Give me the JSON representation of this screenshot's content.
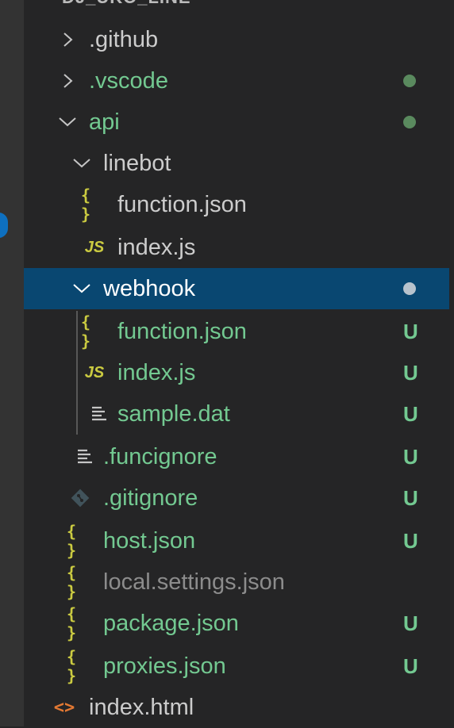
{
  "explorer": {
    "root_label": "DJ_UKO_LINE",
    "colors": {
      "untracked": "#73c991",
      "plain": "#cccccc",
      "ignored": "#8c8c8c",
      "selected_bg": "#094771",
      "json_icon": "#cbcb41",
      "js_icon": "#cbcb41",
      "html_icon": "#e37933"
    },
    "items": [
      {
        "label": ".github",
        "icon": "chevron-right-icon",
        "status": ""
      },
      {
        "label": ".vscode",
        "icon": "chevron-right-icon",
        "status": "dot"
      },
      {
        "label": "api",
        "icon": "chevron-down-icon",
        "status": "dot"
      },
      {
        "label": "linebot",
        "icon": "chevron-down-icon",
        "status": ""
      },
      {
        "label": "function.json",
        "icon": "json-file-icon",
        "icon_text": "{ }",
        "status": ""
      },
      {
        "label": "index.js",
        "icon": "js-file-icon",
        "icon_text": "JS",
        "status": ""
      },
      {
        "label": "webhook",
        "icon": "chevron-down-icon",
        "status": "dot",
        "selected": true
      },
      {
        "label": "function.json",
        "icon": "json-file-icon",
        "icon_text": "{ }",
        "status": "U"
      },
      {
        "label": "index.js",
        "icon": "js-file-icon",
        "icon_text": "JS",
        "status": "U"
      },
      {
        "label": "sample.dat",
        "icon": "text-file-icon",
        "status": "U"
      },
      {
        "label": ".funcignore",
        "icon": "text-file-icon",
        "status": "U"
      },
      {
        "label": ".gitignore",
        "icon": "git-file-icon",
        "status": "U"
      },
      {
        "label": "host.json",
        "icon": "json-file-icon",
        "icon_text": "{ }",
        "status": "U"
      },
      {
        "label": "local.settings.json",
        "icon": "json-file-icon",
        "icon_text": "{ }",
        "status": ""
      },
      {
        "label": "package.json",
        "icon": "json-file-icon",
        "icon_text": "{ }",
        "status": "U"
      },
      {
        "label": "proxies.json",
        "icon": "json-file-icon",
        "icon_text": "{ }",
        "status": "U"
      },
      {
        "label": "index.html",
        "icon": "html-file-icon",
        "icon_text": "<>",
        "status": ""
      }
    ]
  }
}
